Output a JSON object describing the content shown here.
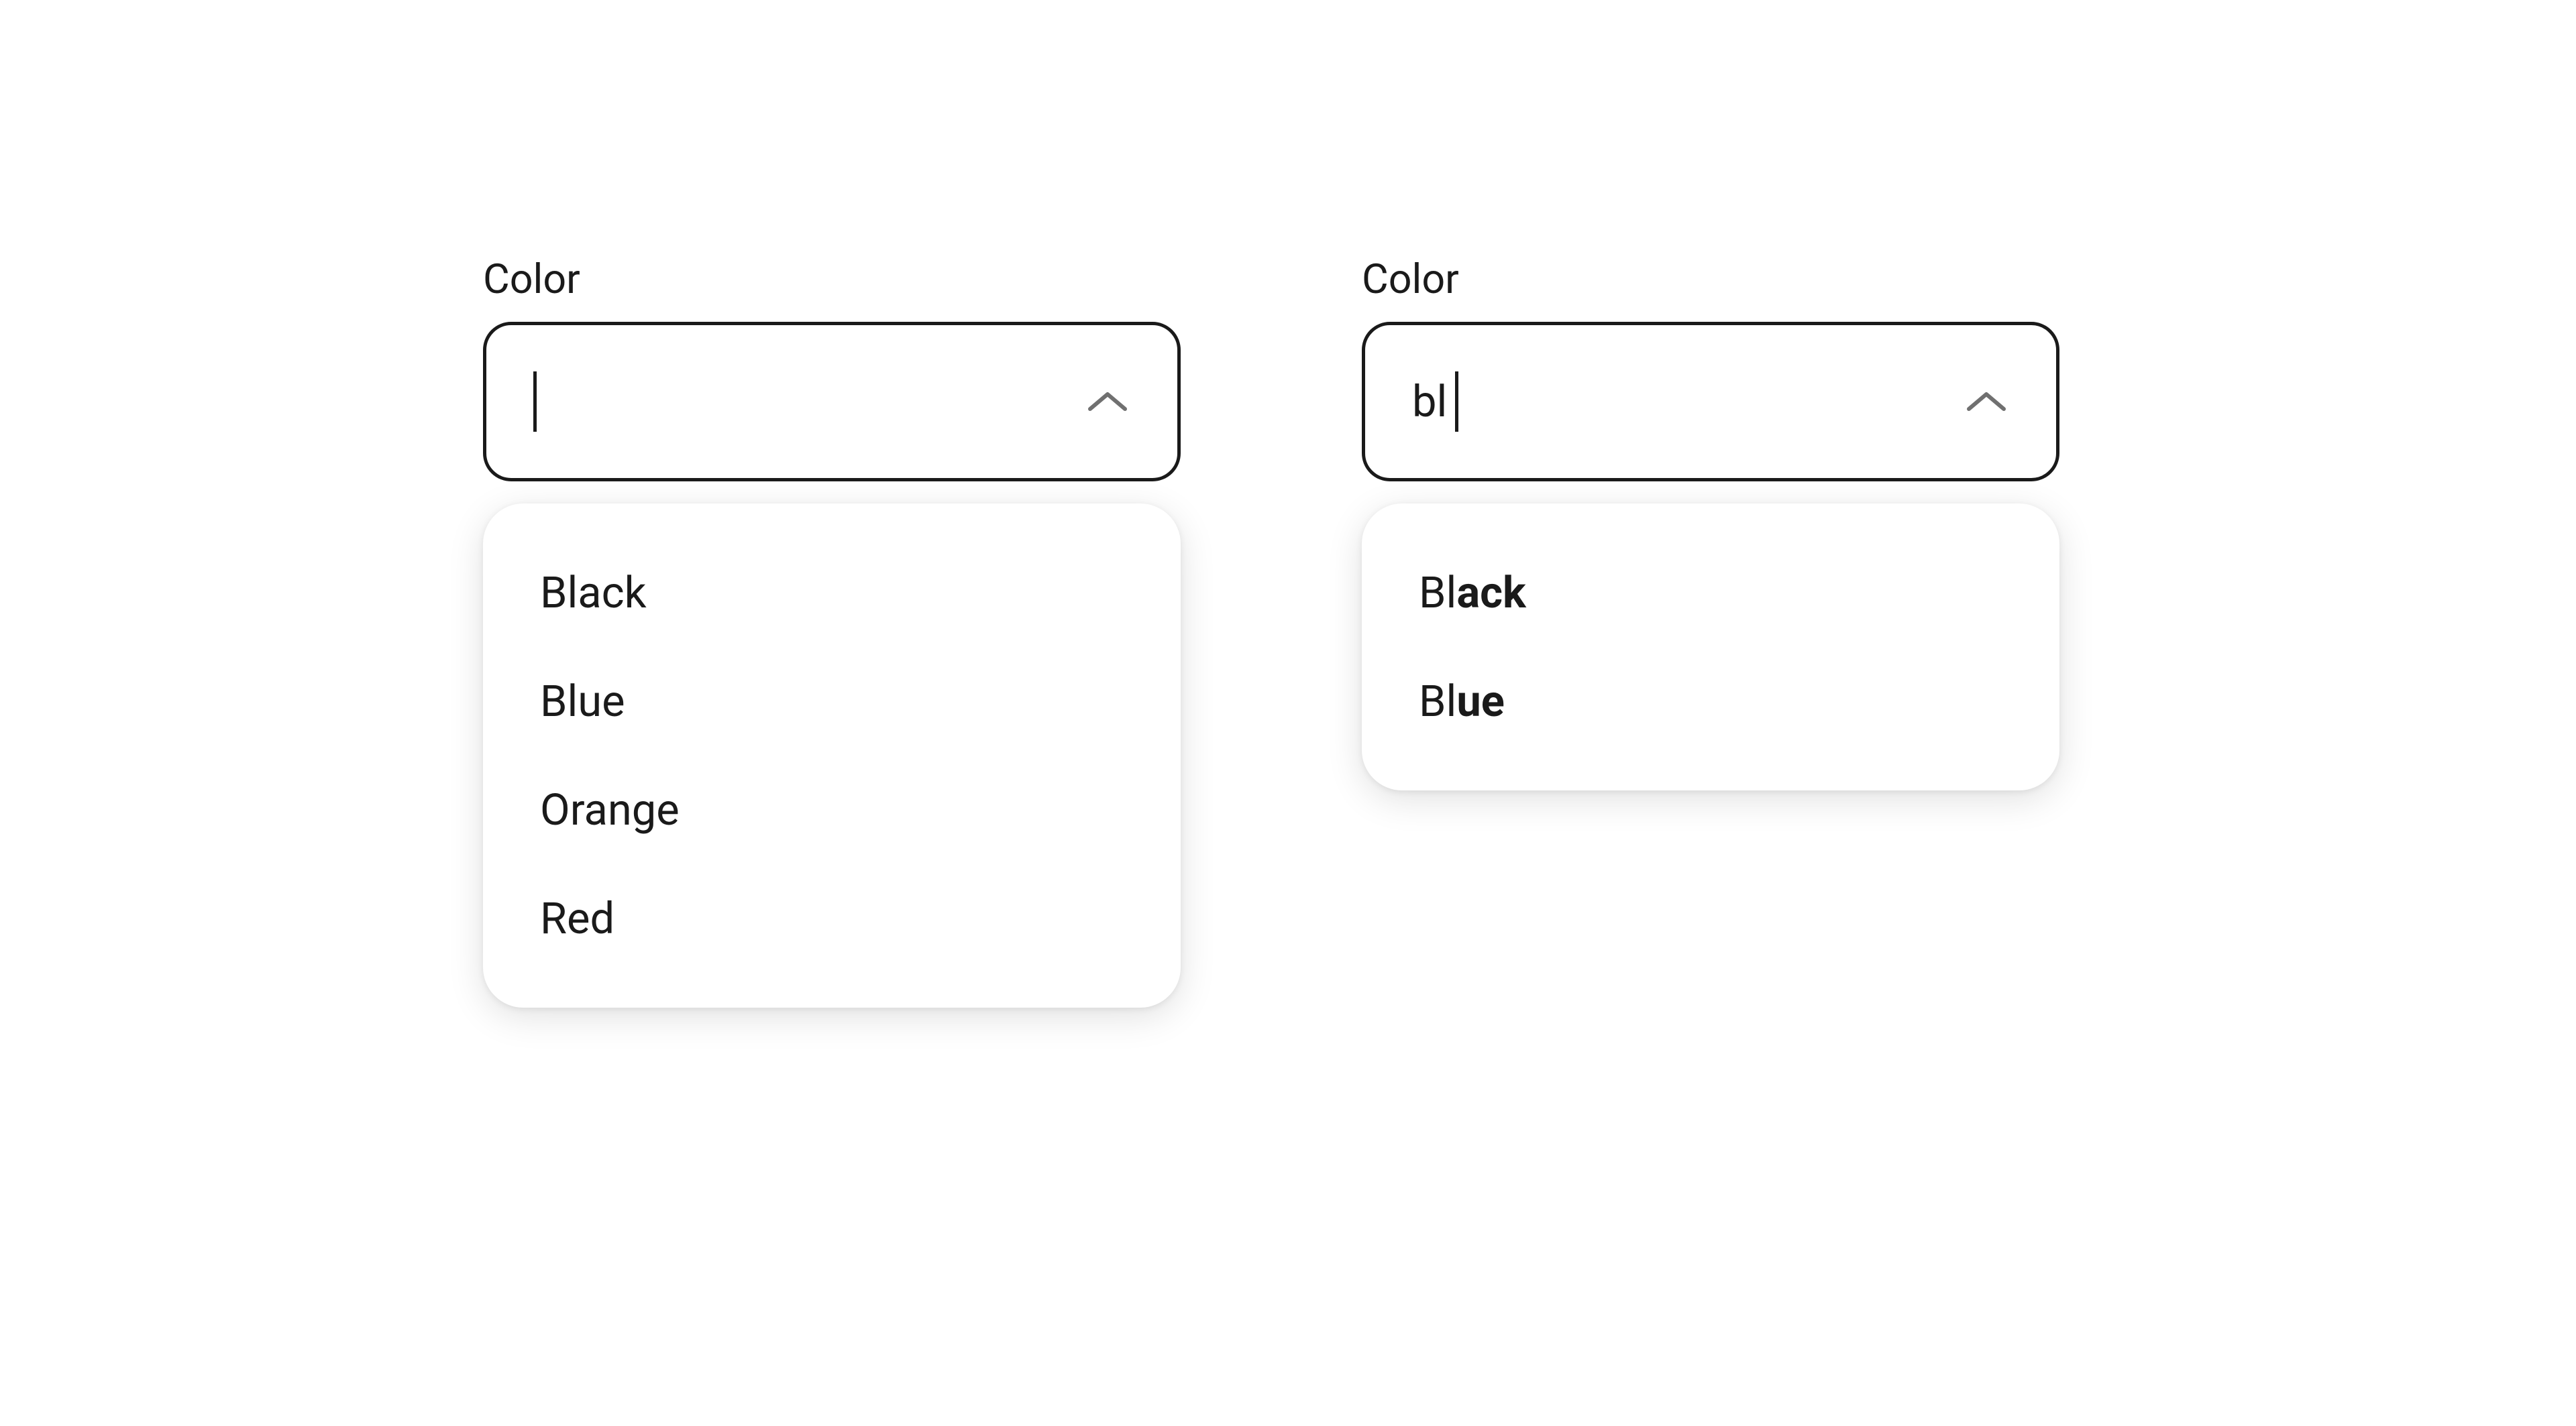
{
  "left": {
    "label": "Color",
    "input_value": "",
    "options": [
      {
        "label": "Black"
      },
      {
        "label": "Blue"
      },
      {
        "label": "Orange"
      },
      {
        "label": "Red"
      }
    ]
  },
  "right": {
    "label": "Color",
    "input_value": "bl",
    "filtered_options": [
      {
        "prefix": "Bl",
        "rest": "ack"
      },
      {
        "prefix": "Bl",
        "rest": "ue"
      }
    ]
  }
}
